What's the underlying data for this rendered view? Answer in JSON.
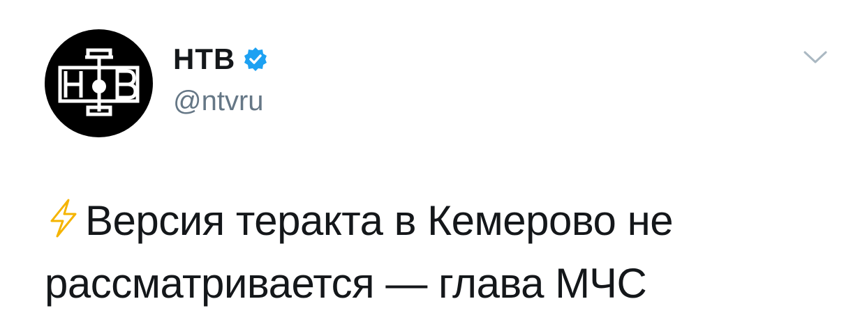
{
  "account": {
    "display_name": "НТВ",
    "handle": "@ntvru",
    "verified": true,
    "avatar_logo_letters": "НТВ"
  },
  "tweet": {
    "leading_icon": "lightning-icon",
    "text": "Версия теракта в Кемерово не рассматривается — глава МЧС"
  },
  "icons": {
    "menu": "chevron-down-icon",
    "verified": "verified-badge-icon"
  },
  "colors": {
    "verified_blue": "#1da1f2",
    "text": "#14171a",
    "secondary_text": "#657786",
    "bolt_stroke": "#f5b400"
  }
}
